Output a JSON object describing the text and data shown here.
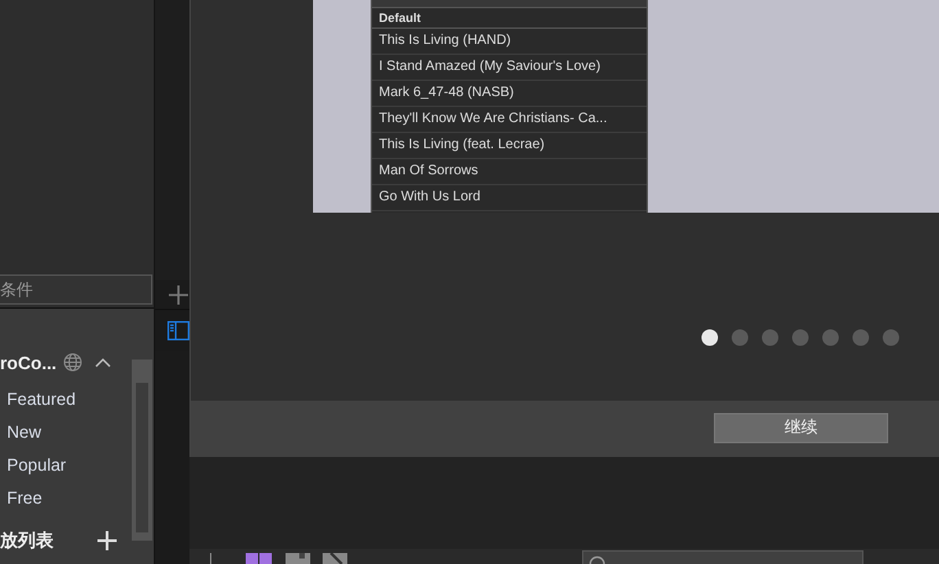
{
  "sidebar": {
    "filter_field": {
      "value": "条件"
    },
    "library": {
      "title": "roCo...",
      "expanded": true,
      "items": [
        {
          "label": "Featured"
        },
        {
          "label": "New"
        },
        {
          "label": "Popular"
        },
        {
          "label": "Free"
        }
      ]
    },
    "playlists_title": "放列表"
  },
  "dialog": {
    "list": {
      "header": "Default",
      "items": [
        "This Is Living (HAND)",
        "I Stand Amazed (My Saviour's Love)",
        "Mark 6_47-48 (NASB)",
        "They'll Know We Are Christians- Ca...",
        "This Is Living (feat. Lecrae)",
        "Man Of Sorrows",
        "Go With Us Lord"
      ]
    },
    "pager": [
      {
        "selected": true
      },
      {
        "selected": false
      },
      {
        "selected": false
      },
      {
        "selected": false
      },
      {
        "selected": false
      },
      {
        "selected": false
      },
      {
        "selected": false
      }
    ],
    "continue_button": "继续"
  }
}
